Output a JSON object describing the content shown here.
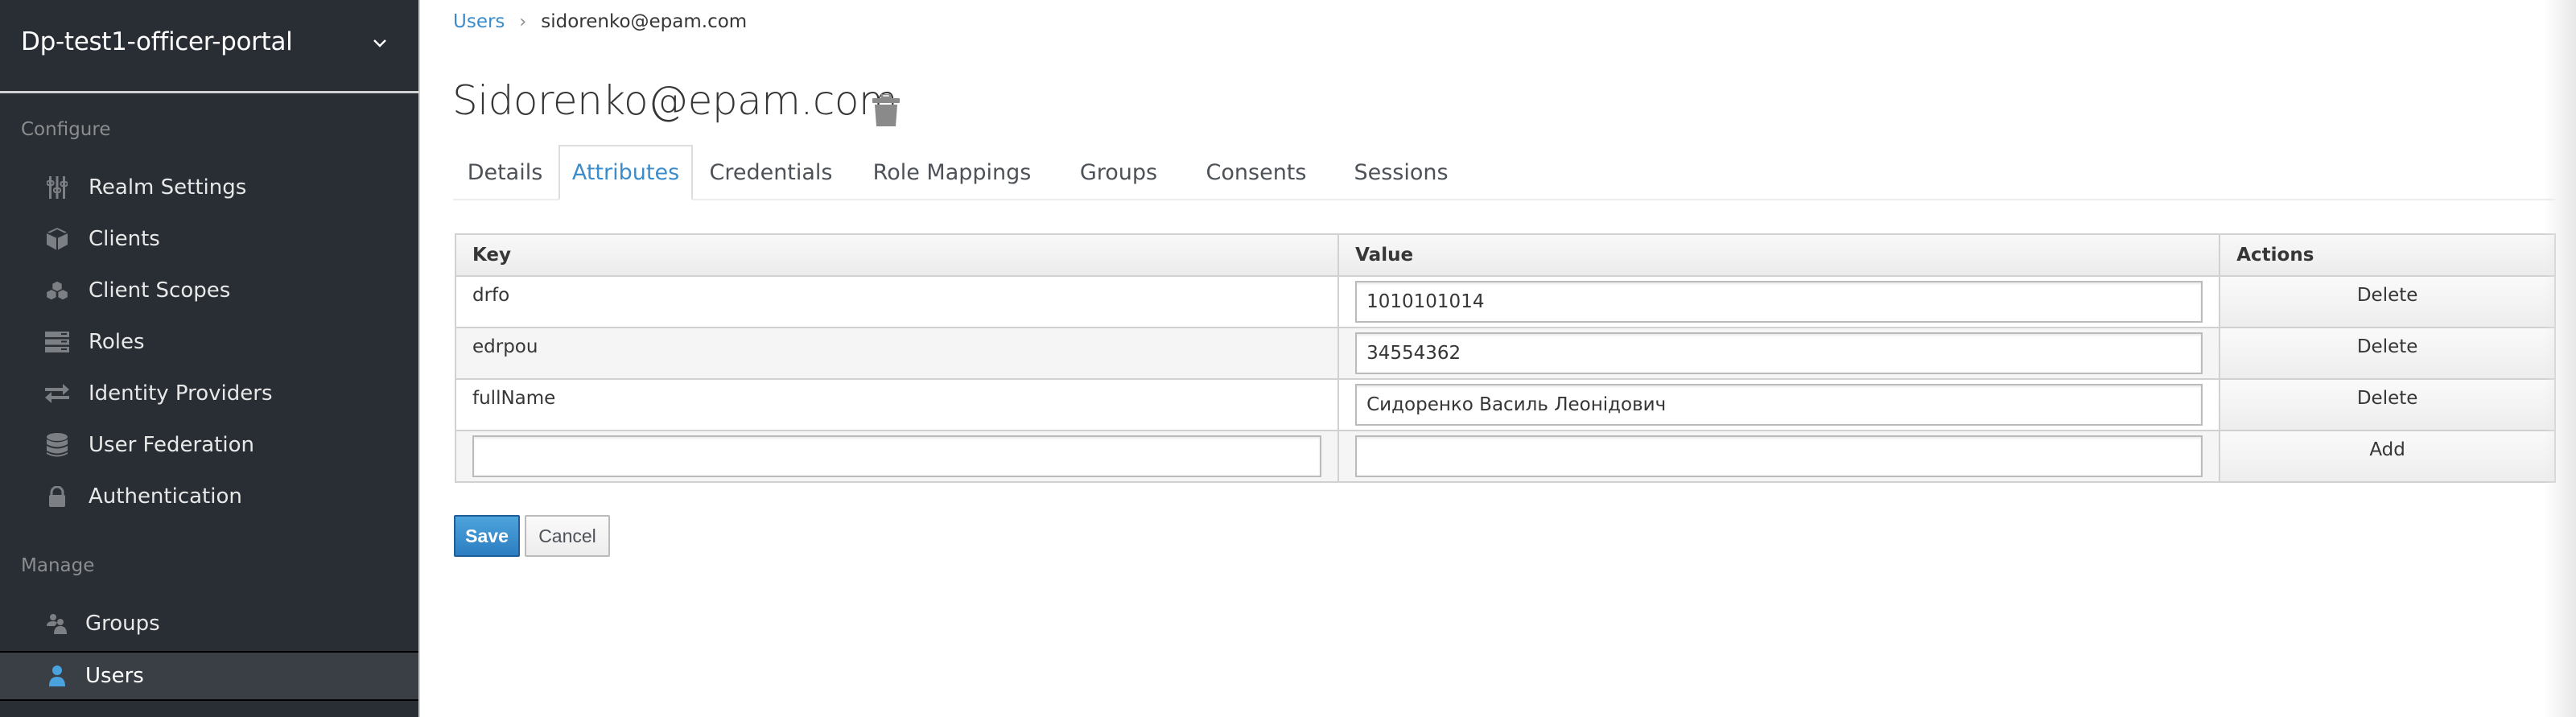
{
  "sidebar": {
    "realm_name": "Dp-test1-officer-portal",
    "realm_dropdown_icon": "chevron-down-icon",
    "configure_label": "Configure",
    "configure_items": [
      {
        "label": "Realm Settings",
        "icon": "sliders-icon"
      },
      {
        "label": "Clients",
        "icon": "cube-icon"
      },
      {
        "label": "Client Scopes",
        "icon": "cubes-icon"
      },
      {
        "label": "Roles",
        "icon": "server-icon"
      },
      {
        "label": "Identity Providers",
        "icon": "exchange-icon"
      },
      {
        "label": "User Federation",
        "icon": "database-icon"
      },
      {
        "label": "Authentication",
        "icon": "lock-icon"
      }
    ],
    "manage_label": "Manage",
    "manage_items": [
      {
        "label": "Groups",
        "icon": "users-icon"
      },
      {
        "label": "Users",
        "icon": "user-icon",
        "active": true
      }
    ],
    "active_color": "#4aa3df"
  },
  "breadcrumb": {
    "parent": "Users",
    "separator": "›",
    "current": "sidorenko@epam.com"
  },
  "page": {
    "title": "Sidorenko@epam.com",
    "delete_icon": "trash-icon"
  },
  "tabs": [
    {
      "label": "Details"
    },
    {
      "label": "Attributes",
      "active": true
    },
    {
      "label": "Credentials"
    },
    {
      "label": "Role Mappings"
    },
    {
      "label": "Groups"
    },
    {
      "label": "Consents"
    },
    {
      "label": "Sessions"
    }
  ],
  "attributes": {
    "headers": {
      "key": "Key",
      "value": "Value",
      "actions": "Actions"
    },
    "rows": [
      {
        "key": "drfo",
        "value": "1010101014",
        "action": "Delete"
      },
      {
        "key": "edrpou",
        "value": "34554362",
        "action": "Delete"
      },
      {
        "key": "fullName",
        "value": "Сидоренко Василь Леонідович",
        "action": "Delete"
      }
    ],
    "new_row": {
      "key": "",
      "value": "",
      "action": "Add"
    }
  },
  "form": {
    "save_label": "Save",
    "cancel_label": "Cancel"
  },
  "colors": {
    "sidebar_bg": "#292e34",
    "link": "#3b8ccb",
    "primary_button": "#3a8fd0"
  }
}
